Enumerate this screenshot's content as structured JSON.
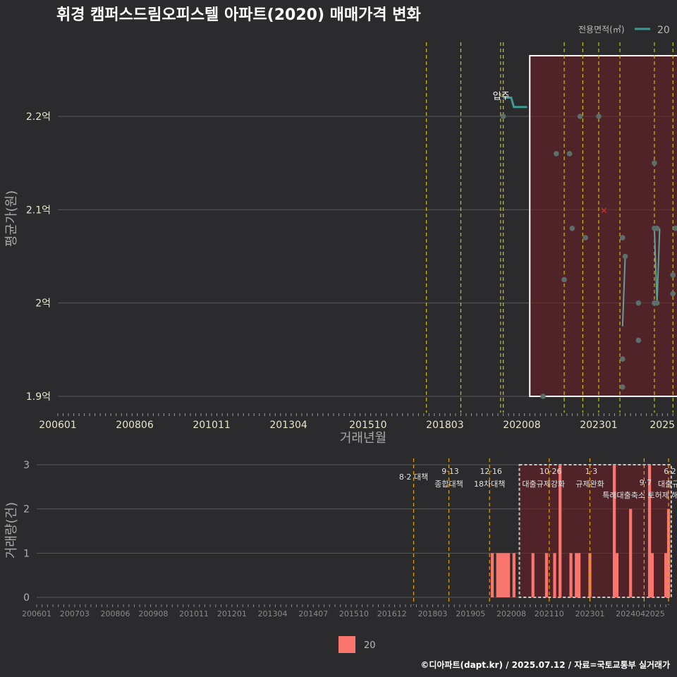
{
  "title": "휘경 캠퍼스드림오피스텔 아파트(2020) 매매가격 변화",
  "legend": {
    "title": "전용면적(㎡)",
    "item": "20",
    "line_color": "#3d9a95"
  },
  "credit": "©디아파트(dapt.kr) / 2025.07.12 / 자료=국토교통부 실거래가",
  "bottom_legend_label": "20",
  "chart_data": [
    {
      "type": "scatter",
      "title": "휘경 캠퍼스드림오피스텔 아파트(2020) 매매가격 변화",
      "xlabel": "거래년월",
      "ylabel": "평균가(원)",
      "x_ticks": [
        "200601",
        "200806",
        "201011",
        "201304",
        "201510",
        "201803",
        "202008",
        "202301",
        "2025"
      ],
      "y_ticks": [
        "1.9억",
        "2억",
        "2.1억",
        "2.2억"
      ],
      "ylim": [
        1.9,
        2.27
      ],
      "y_unit": "억",
      "annotation": "입주",
      "points": [
        {
          "x": "2020-01",
          "y": 2.2
        },
        {
          "x": "2021-09",
          "y": 2.16
        },
        {
          "x": "2022-02",
          "y": 2.16
        },
        {
          "x": "2022-06",
          "y": 2.2
        },
        {
          "x": "2023-01",
          "y": 2.2
        },
        {
          "x": "2022-03",
          "y": 2.08
        },
        {
          "x": "2022-08",
          "y": 2.07
        },
        {
          "x": "2021-12",
          "y": 2.025
        },
        {
          "x": "2021-04",
          "y": 1.9
        },
        {
          "x": "2023-10",
          "y": 2.07
        },
        {
          "x": "2023-11",
          "y": 2.05
        },
        {
          "x": "2023-10",
          "y": 1.94
        },
        {
          "x": "2023-10",
          "y": 1.91
        },
        {
          "x": "2024-04",
          "y": 2.0
        },
        {
          "x": "2024-04",
          "y": 1.96
        },
        {
          "x": "2024-10",
          "y": 2.15
        },
        {
          "x": "2024-10",
          "y": 2.08
        },
        {
          "x": "2024-11",
          "y": 2.08
        },
        {
          "x": "2024-10",
          "y": 2.0
        },
        {
          "x": "2024-11",
          "y": 2.0
        },
        {
          "x": "2025-06",
          "y": 2.08
        },
        {
          "x": "2025-05",
          "y": 2.03
        },
        {
          "x": "2025-05",
          "y": 2.01
        }
      ],
      "line": [
        {
          "x": "2020-01",
          "y": 2.22
        },
        {
          "x": "2020-04",
          "y": 2.22
        },
        {
          "x": "2020-05",
          "y": 2.21
        },
        {
          "x": "2020-08",
          "y": 2.21
        },
        {
          "x": "2020-09",
          "y": 2.21
        },
        {
          "x": "2020-10",
          "y": 2.21
        }
      ],
      "line_segments": [
        [
          {
            "x": "2023-10",
            "y": 1.975
          },
          {
            "x": "2023-11",
            "y": 2.05
          }
        ],
        [
          {
            "x": "2024-10",
            "y": 2.08
          },
          {
            "x": "2024-11",
            "y": 2.0
          }
        ],
        [
          {
            "x": "2024-11",
            "y": 2.0
          },
          {
            "x": "2024-12",
            "y": 2.08
          }
        ]
      ],
      "mean_marker": {
        "x": "2023-03",
        "y": 2.1
      },
      "highlight_range": {
        "from": "2020-11",
        "to": "2025-07",
        "y_from": 1.9,
        "y_to": 2.265
      },
      "event_lines": [
        "2017-08",
        "2018-09",
        "2019-12",
        "2020-01",
        "2021-12",
        "2022-07",
        "2023-01",
        "2023-09",
        "2024-10",
        "2025-05"
      ]
    },
    {
      "type": "bar",
      "ylabel": "거래량(건)",
      "x_ticks": [
        "200601",
        "200703",
        "200806",
        "200908",
        "201011",
        "201201",
        "201304",
        "201407",
        "201510",
        "201612",
        "201803",
        "201905",
        "202008",
        "202110",
        "202301",
        "202404",
        "2025"
      ],
      "y_ticks": [
        "0",
        "1",
        "2",
        "3"
      ],
      "ylim": [
        0,
        3
      ],
      "bar_color": "#f8766d",
      "bars": [
        {
          "x": "2020-01",
          "v": 1
        },
        {
          "x": "2020-03",
          "v": 1
        },
        {
          "x": "2020-04",
          "v": 1
        },
        {
          "x": "2020-05",
          "v": 1
        },
        {
          "x": "2020-06",
          "v": 1
        },
        {
          "x": "2020-07",
          "v": 1
        },
        {
          "x": "2020-09",
          "v": 1
        },
        {
          "x": "2021-04",
          "v": 1
        },
        {
          "x": "2021-09",
          "v": 1
        },
        {
          "x": "2021-12",
          "v": 1
        },
        {
          "x": "2022-02",
          "v": 3
        },
        {
          "x": "2022-06",
          "v": 1
        },
        {
          "x": "2022-08",
          "v": 1
        },
        {
          "x": "2022-09",
          "v": 1
        },
        {
          "x": "2023-01",
          "v": 1
        },
        {
          "x": "2023-10",
          "v": 3
        },
        {
          "x": "2023-11",
          "v": 1
        },
        {
          "x": "2024-04",
          "v": 2
        },
        {
          "x": "2024-11",
          "v": 3
        },
        {
          "x": "2024-12",
          "v": 1
        },
        {
          "x": "2025-05",
          "v": 1
        },
        {
          "x": "2025-06",
          "v": 2
        }
      ],
      "events": [
        {
          "x": "2017-08",
          "date": "",
          "label": "8·2 대책"
        },
        {
          "x": "2018-09",
          "date": "9·13",
          "label": "종합대책"
        },
        {
          "x": "2019-12",
          "date": "12·16",
          "label": "18차대책"
        },
        {
          "x": "2021-10",
          "date": "10·26",
          "label": "대출규제강화"
        },
        {
          "x": "2023-01",
          "date": "1·3",
          "label": "규제완화"
        },
        {
          "x": "2024-09",
          "date": "9·7",
          "label": "특례대출축소 토허제 해제"
        },
        {
          "x": "2025-06",
          "date": "6·2",
          "label": "대출규"
        }
      ],
      "highlight_range": {
        "from": "2020-11",
        "to": "2025-07"
      }
    }
  ]
}
